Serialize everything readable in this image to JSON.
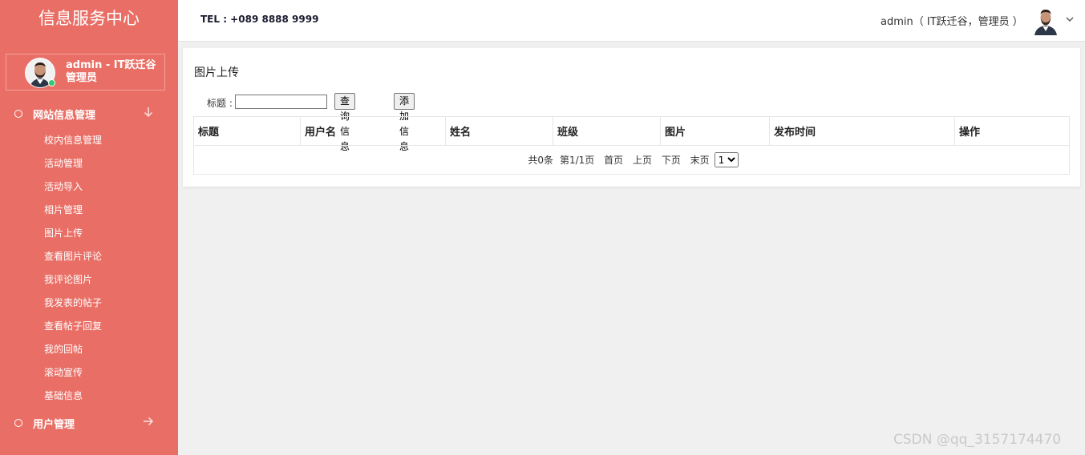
{
  "sidebar": {
    "brand": "信息服务中心",
    "user_name": "admin - IT跃迁谷管理员",
    "groups": [
      {
        "label": "网站信息管理",
        "items": [
          "校内信息管理",
          "活动管理",
          "活动导入",
          "相片管理",
          "图片上传",
          "查看图片评论",
          "我评论图片",
          "我发表的帖子",
          "查看帖子回复",
          "我的回帖",
          "滚动宣传",
          "基础信息"
        ]
      },
      {
        "label": "用户管理"
      }
    ]
  },
  "header": {
    "tel": "TEL : +089 8888 9999",
    "user": "admin（ IT跃迁谷，管理员 ）"
  },
  "main": {
    "title": "图片上传",
    "search": {
      "label": "标题 :",
      "value": "",
      "query_btn": "查询信息",
      "add_btn": "添加信息"
    },
    "table": {
      "columns": [
        "标题",
        "用户名",
        "姓名",
        "班级",
        "图片",
        "发布时间",
        "操作"
      ],
      "rows": []
    },
    "pager": {
      "total": "共0条",
      "page": "第1/1页",
      "first": "首页",
      "prev": "上页",
      "next": "下页",
      "last": "末页",
      "selected_page": "1"
    }
  },
  "watermark": "CSDN @qq_3157174470",
  "colors": {
    "sidebar_bg": "#e96f66",
    "online": "#2ecc71"
  }
}
